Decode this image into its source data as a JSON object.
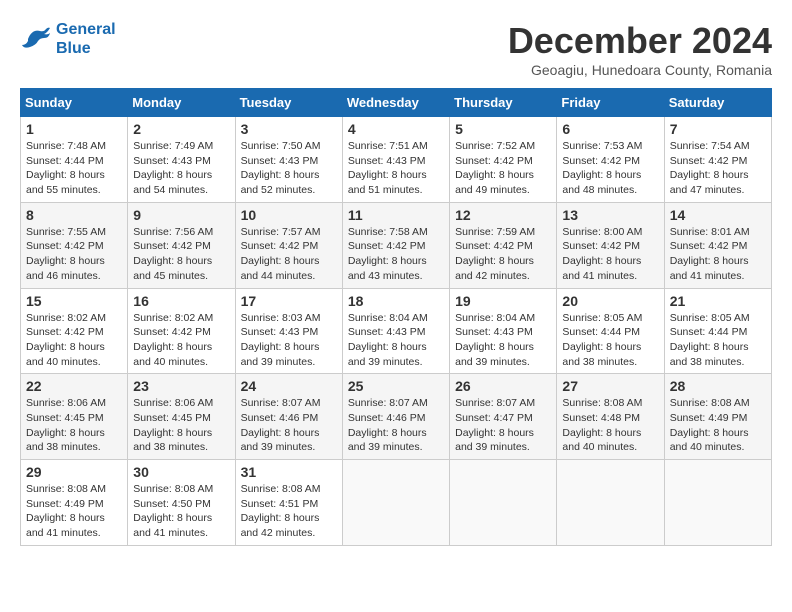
{
  "header": {
    "logo_line1": "General",
    "logo_line2": "Blue",
    "month_title": "December 2024",
    "subtitle": "Geoagiu, Hunedoara County, Romania"
  },
  "days_of_week": [
    "Sunday",
    "Monday",
    "Tuesday",
    "Wednesday",
    "Thursday",
    "Friday",
    "Saturday"
  ],
  "weeks": [
    [
      {
        "day": "1",
        "info": "Sunrise: 7:48 AM\nSunset: 4:44 PM\nDaylight: 8 hours and 55 minutes."
      },
      {
        "day": "2",
        "info": "Sunrise: 7:49 AM\nSunset: 4:43 PM\nDaylight: 8 hours and 54 minutes."
      },
      {
        "day": "3",
        "info": "Sunrise: 7:50 AM\nSunset: 4:43 PM\nDaylight: 8 hours and 52 minutes."
      },
      {
        "day": "4",
        "info": "Sunrise: 7:51 AM\nSunset: 4:43 PM\nDaylight: 8 hours and 51 minutes."
      },
      {
        "day": "5",
        "info": "Sunrise: 7:52 AM\nSunset: 4:42 PM\nDaylight: 8 hours and 49 minutes."
      },
      {
        "day": "6",
        "info": "Sunrise: 7:53 AM\nSunset: 4:42 PM\nDaylight: 8 hours and 48 minutes."
      },
      {
        "day": "7",
        "info": "Sunrise: 7:54 AM\nSunset: 4:42 PM\nDaylight: 8 hours and 47 minutes."
      }
    ],
    [
      {
        "day": "8",
        "info": "Sunrise: 7:55 AM\nSunset: 4:42 PM\nDaylight: 8 hours and 46 minutes."
      },
      {
        "day": "9",
        "info": "Sunrise: 7:56 AM\nSunset: 4:42 PM\nDaylight: 8 hours and 45 minutes."
      },
      {
        "day": "10",
        "info": "Sunrise: 7:57 AM\nSunset: 4:42 PM\nDaylight: 8 hours and 44 minutes."
      },
      {
        "day": "11",
        "info": "Sunrise: 7:58 AM\nSunset: 4:42 PM\nDaylight: 8 hours and 43 minutes."
      },
      {
        "day": "12",
        "info": "Sunrise: 7:59 AM\nSunset: 4:42 PM\nDaylight: 8 hours and 42 minutes."
      },
      {
        "day": "13",
        "info": "Sunrise: 8:00 AM\nSunset: 4:42 PM\nDaylight: 8 hours and 41 minutes."
      },
      {
        "day": "14",
        "info": "Sunrise: 8:01 AM\nSunset: 4:42 PM\nDaylight: 8 hours and 41 minutes."
      }
    ],
    [
      {
        "day": "15",
        "info": "Sunrise: 8:02 AM\nSunset: 4:42 PM\nDaylight: 8 hours and 40 minutes."
      },
      {
        "day": "16",
        "info": "Sunrise: 8:02 AM\nSunset: 4:42 PM\nDaylight: 8 hours and 40 minutes."
      },
      {
        "day": "17",
        "info": "Sunrise: 8:03 AM\nSunset: 4:43 PM\nDaylight: 8 hours and 39 minutes."
      },
      {
        "day": "18",
        "info": "Sunrise: 8:04 AM\nSunset: 4:43 PM\nDaylight: 8 hours and 39 minutes."
      },
      {
        "day": "19",
        "info": "Sunrise: 8:04 AM\nSunset: 4:43 PM\nDaylight: 8 hours and 39 minutes."
      },
      {
        "day": "20",
        "info": "Sunrise: 8:05 AM\nSunset: 4:44 PM\nDaylight: 8 hours and 38 minutes."
      },
      {
        "day": "21",
        "info": "Sunrise: 8:05 AM\nSunset: 4:44 PM\nDaylight: 8 hours and 38 minutes."
      }
    ],
    [
      {
        "day": "22",
        "info": "Sunrise: 8:06 AM\nSunset: 4:45 PM\nDaylight: 8 hours and 38 minutes."
      },
      {
        "day": "23",
        "info": "Sunrise: 8:06 AM\nSunset: 4:45 PM\nDaylight: 8 hours and 38 minutes."
      },
      {
        "day": "24",
        "info": "Sunrise: 8:07 AM\nSunset: 4:46 PM\nDaylight: 8 hours and 39 minutes."
      },
      {
        "day": "25",
        "info": "Sunrise: 8:07 AM\nSunset: 4:46 PM\nDaylight: 8 hours and 39 minutes."
      },
      {
        "day": "26",
        "info": "Sunrise: 8:07 AM\nSunset: 4:47 PM\nDaylight: 8 hours and 39 minutes."
      },
      {
        "day": "27",
        "info": "Sunrise: 8:08 AM\nSunset: 4:48 PM\nDaylight: 8 hours and 40 minutes."
      },
      {
        "day": "28",
        "info": "Sunrise: 8:08 AM\nSunset: 4:49 PM\nDaylight: 8 hours and 40 minutes."
      }
    ],
    [
      {
        "day": "29",
        "info": "Sunrise: 8:08 AM\nSunset: 4:49 PM\nDaylight: 8 hours and 41 minutes."
      },
      {
        "day": "30",
        "info": "Sunrise: 8:08 AM\nSunset: 4:50 PM\nDaylight: 8 hours and 41 minutes."
      },
      {
        "day": "31",
        "info": "Sunrise: 8:08 AM\nSunset: 4:51 PM\nDaylight: 8 hours and 42 minutes."
      },
      {
        "day": "",
        "info": ""
      },
      {
        "day": "",
        "info": ""
      },
      {
        "day": "",
        "info": ""
      },
      {
        "day": "",
        "info": ""
      }
    ]
  ]
}
